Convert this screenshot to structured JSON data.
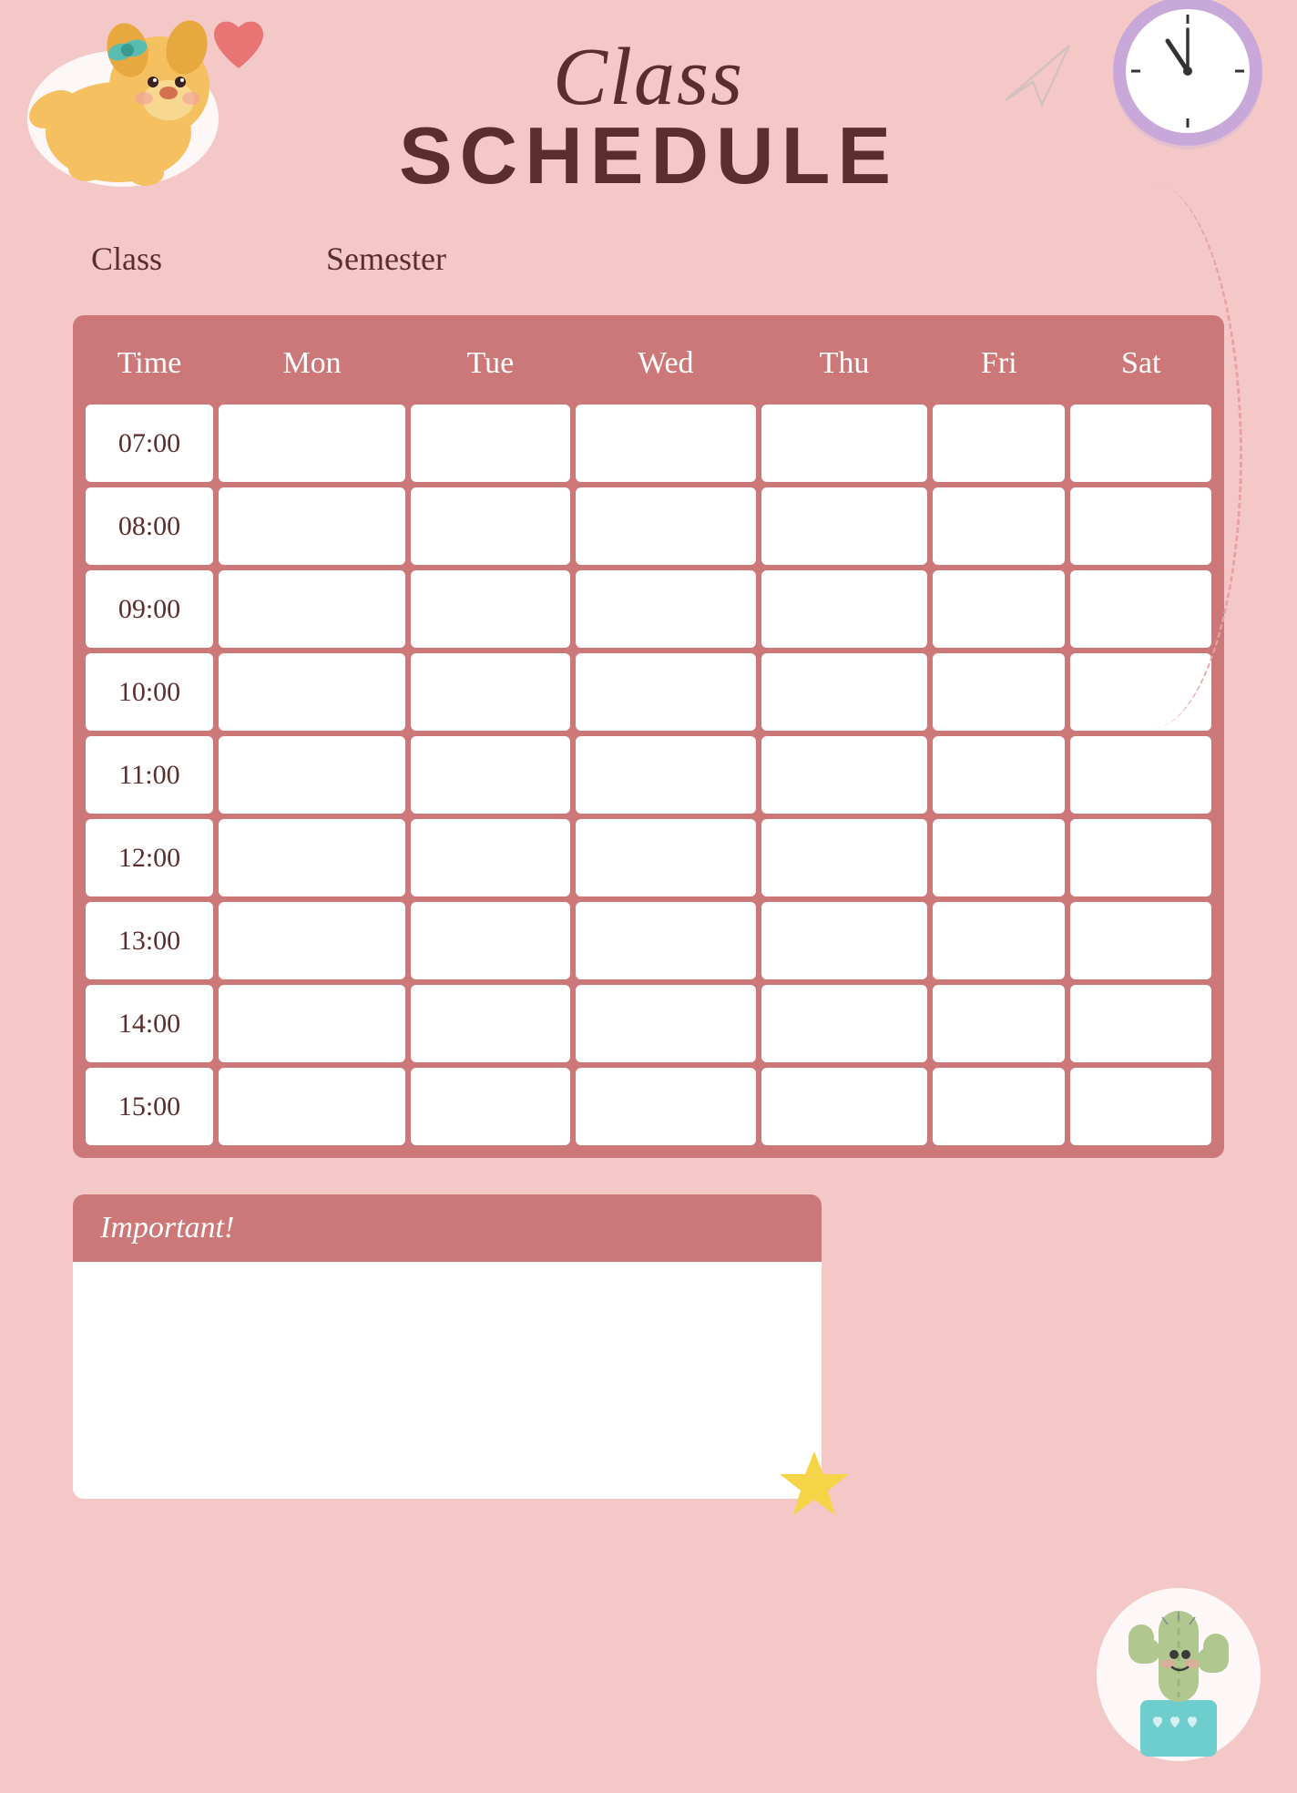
{
  "page": {
    "background_color": "#f5c8c8"
  },
  "header": {
    "title_line1": "Class",
    "title_line2": "SCHEDULE"
  },
  "fields": {
    "class_label": "Class",
    "semester_label": "Semester",
    "class_value": "",
    "semester_value": ""
  },
  "table": {
    "columns": [
      "Time",
      "Mon",
      "Tue",
      "Wed",
      "Thu",
      "Fri",
      "Sat"
    ],
    "rows": [
      "07:00",
      "08:00",
      "09:00",
      "10:00",
      "11:00",
      "12:00",
      "13:00",
      "14:00",
      "15:00"
    ]
  },
  "important": {
    "header": "Important!",
    "body": ""
  },
  "colors": {
    "pink_bg": "#f5c8c8",
    "dark_rose": "#cd7878",
    "dark_brown": "#5c2d2d",
    "white": "#ffffff",
    "heart_pink": "#e87474",
    "star_yellow": "#f5d547",
    "clock_purple": "#b89ec8",
    "cactus_green": "#a8c8a0",
    "cactus_pot": "#7ecece"
  }
}
